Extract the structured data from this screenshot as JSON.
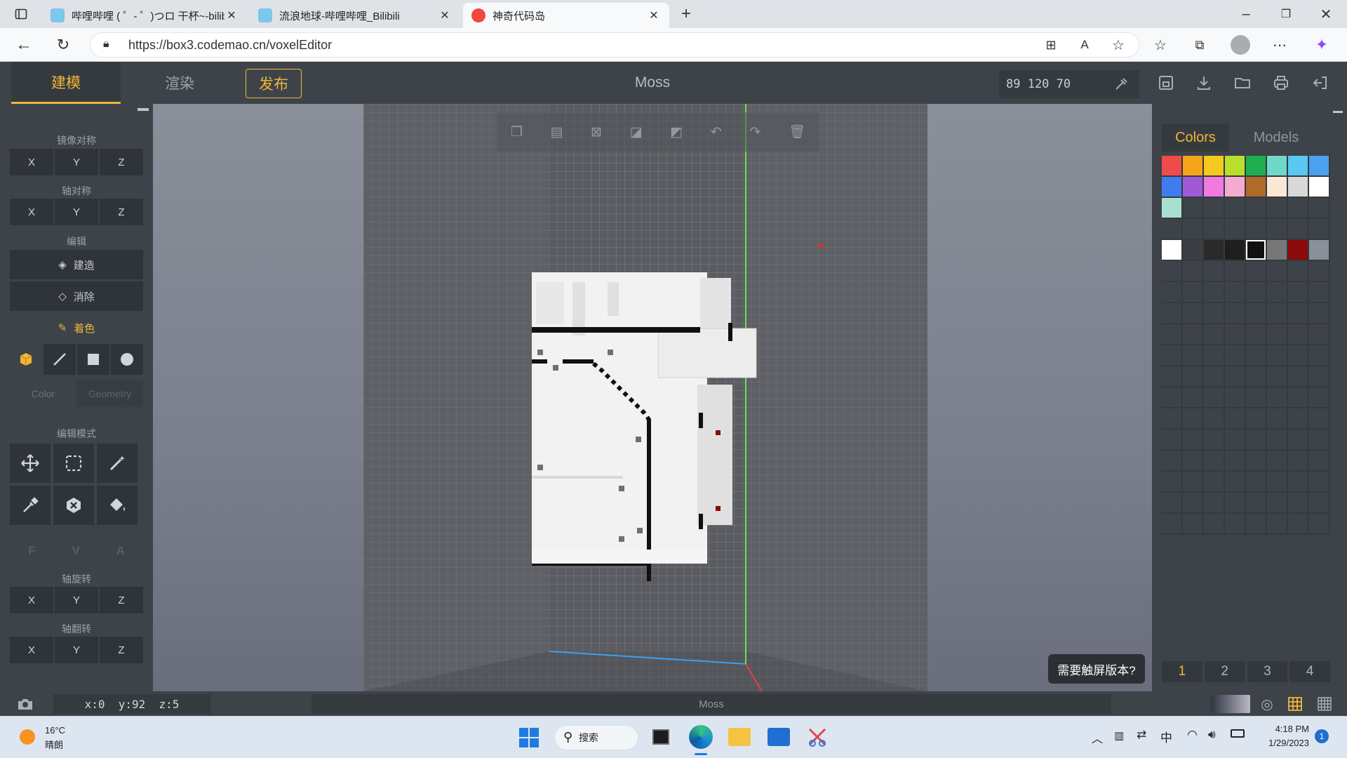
{
  "browser": {
    "tabs": [
      {
        "title": "哔哩哔哩 ( ゜- ゜)つロ 干杯~-bilibili",
        "active": false
      },
      {
        "title": "流浪地球-哔哩哔哩_Bilibili",
        "active": false
      },
      {
        "title": "神奇代码岛",
        "active": true
      }
    ],
    "url": "https://box3.codemao.cn/voxelEditor"
  },
  "app": {
    "tabs": {
      "model": "建模",
      "render": "渲染",
      "publish": "发布"
    },
    "title": "Moss",
    "coords_input": "89 120 70"
  },
  "left": {
    "mirror_label": "镜像对称",
    "axis_label": "轴对称",
    "edit_label": "编辑",
    "build_label": "建造",
    "erase_label": "消除",
    "paint_label": "着色",
    "color_tab": "Color",
    "geometry_tab": "Geometry",
    "edit_mode_label": "编辑模式",
    "fva": [
      "F",
      "V",
      "A"
    ],
    "rotate_label": "轴旋转",
    "flip_label": "轴翻转",
    "xyz": [
      "X",
      "Y",
      "Z"
    ]
  },
  "right": {
    "colors_tab": "Colors",
    "models_tab": "Models",
    "palette_row1": [
      "#f04b4b",
      "#f5a51a",
      "#f6c91f",
      "#b7df2c",
      "#1fae4f",
      "#6fd8c9",
      "#5ac8f0",
      "#4aa1f0"
    ],
    "palette_row2": [
      "#3f7cf0",
      "#a05ad8",
      "#f07ae0",
      "#f5aacf",
      "#b06a2a",
      "#fbe8d4",
      "#d8d8d8",
      "#ffffff"
    ],
    "palette_row3": [
      "#a8e0cf"
    ],
    "recent": [
      "#ffffff",
      "#3a3e43",
      "#2a2a2a",
      "#1e1e1e",
      "#111111",
      "#777777",
      "#8b0a0a",
      "#8a9099"
    ],
    "pages": [
      "1",
      "2",
      "3",
      "4"
    ]
  },
  "toast": "需要触屏版本?",
  "status": {
    "coords": "x:0  y:92  z:5",
    "model_name": "Moss"
  },
  "taskbar": {
    "weather_temp": "16°C",
    "weather_desc": "晴朗",
    "search": "搜索",
    "ime": "中",
    "time": "4:18 PM",
    "date": "1/29/2023",
    "notification_count": "1"
  }
}
